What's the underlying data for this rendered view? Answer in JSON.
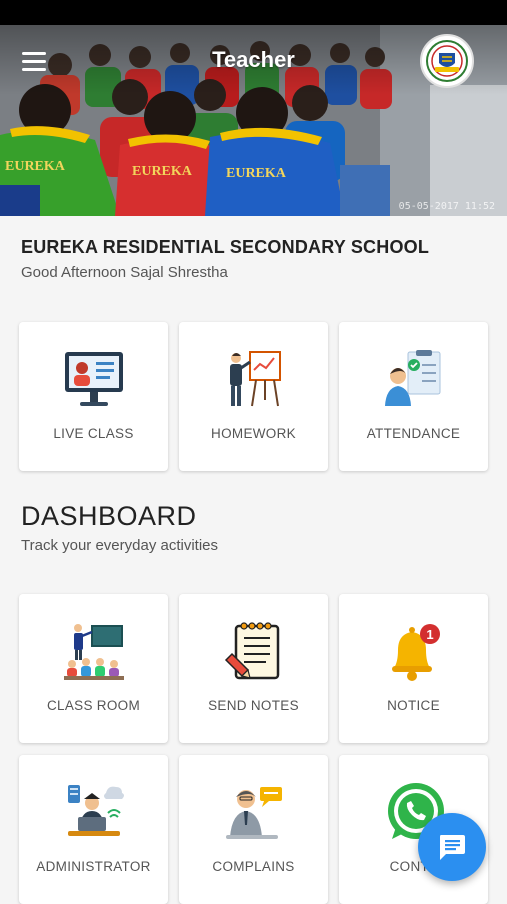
{
  "header": {
    "title": "Teacher",
    "menu_icon": "hamburger-menu-icon",
    "logo_icon": "school-crest-icon",
    "photo_timestamp": "05-05-2017 11:52",
    "shirt_text": "EUREKA"
  },
  "school": {
    "name": "EUREKA RESIDENTIAL SECONDARY SCHOOL",
    "greeting": "Good Afternoon Sajal Shrestha"
  },
  "quick_actions": [
    {
      "label": "LIVE CLASS",
      "icon": "live-class-icon"
    },
    {
      "label": "HOMEWORK",
      "icon": "homework-icon"
    },
    {
      "label": "ATTENDANCE",
      "icon": "attendance-icon"
    }
  ],
  "dashboard": {
    "title": "DASHBOARD",
    "subtitle": "Track your everyday activities",
    "items": [
      {
        "label": "CLASS ROOM",
        "icon": "classroom-icon"
      },
      {
        "label": "SEND NOTES",
        "icon": "notes-icon"
      },
      {
        "label": "NOTICE",
        "icon": "bell-icon",
        "badge": "1"
      },
      {
        "label": "ADMINISTRATOR",
        "icon": "administrator-icon"
      },
      {
        "label": "COMPLAINS",
        "icon": "complains-icon"
      },
      {
        "label": "CONTA",
        "icon": "whatsapp-icon"
      }
    ]
  },
  "fab": {
    "icon": "chat-icon"
  },
  "colors": {
    "accent": "#2b8ff0",
    "background": "#f5f5f5",
    "card": "#ffffff",
    "badge": "#d32f2f"
  }
}
